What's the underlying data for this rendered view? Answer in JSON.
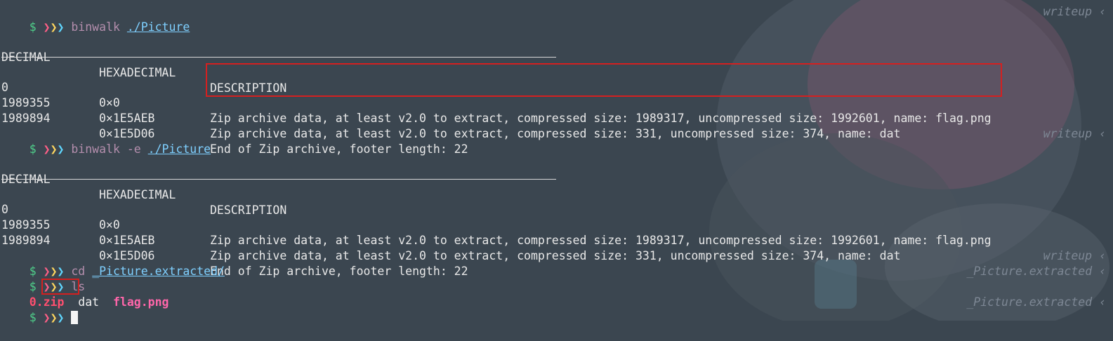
{
  "prompt": {
    "dollar": "$",
    "arrows": [
      "❯",
      "❯",
      "❯"
    ]
  },
  "blocks": [
    {
      "command": "binwalk",
      "flag": "",
      "arg": "./Picture",
      "cwd": "writeup"
    },
    {
      "command": "binwalk",
      "flag": "-e",
      "arg": "./Picture",
      "cwd": "writeup"
    }
  ],
  "table": {
    "headers": [
      "DECIMAL",
      "HEXADECIMAL",
      "DESCRIPTION"
    ],
    "rows": [
      [
        "0",
        "0×0",
        "Zip archive data, at least v2.0 to extract, compressed size: 1989317, uncompressed size: 1992601, name: flag.png"
      ],
      [
        "1989355",
        "0×1E5AEB",
        "Zip archive data, at least v2.0 to extract, compressed size: 331, uncompressed size: 374, name: dat"
      ],
      [
        "1989894",
        "0×1E5D06",
        "End of Zip archive, footer length: 22"
      ]
    ]
  },
  "cd": {
    "command": "cd",
    "arg": "_Picture.extracted/",
    "cwd": "writeup"
  },
  "ls": {
    "command": "ls",
    "cwd": "_Picture.extracted",
    "files": [
      "0.zip",
      "dat",
      "flag.png"
    ]
  },
  "last_prompt": {
    "cwd": "_Picture.extracted"
  },
  "right_chevron": "‹",
  "colors": {
    "background": "#3b4650",
    "highlight_box": "#d42020",
    "prompt_green": "#4fd08a",
    "command_purple": "#b48ead",
    "path_cyan": "#7fd0ff"
  }
}
